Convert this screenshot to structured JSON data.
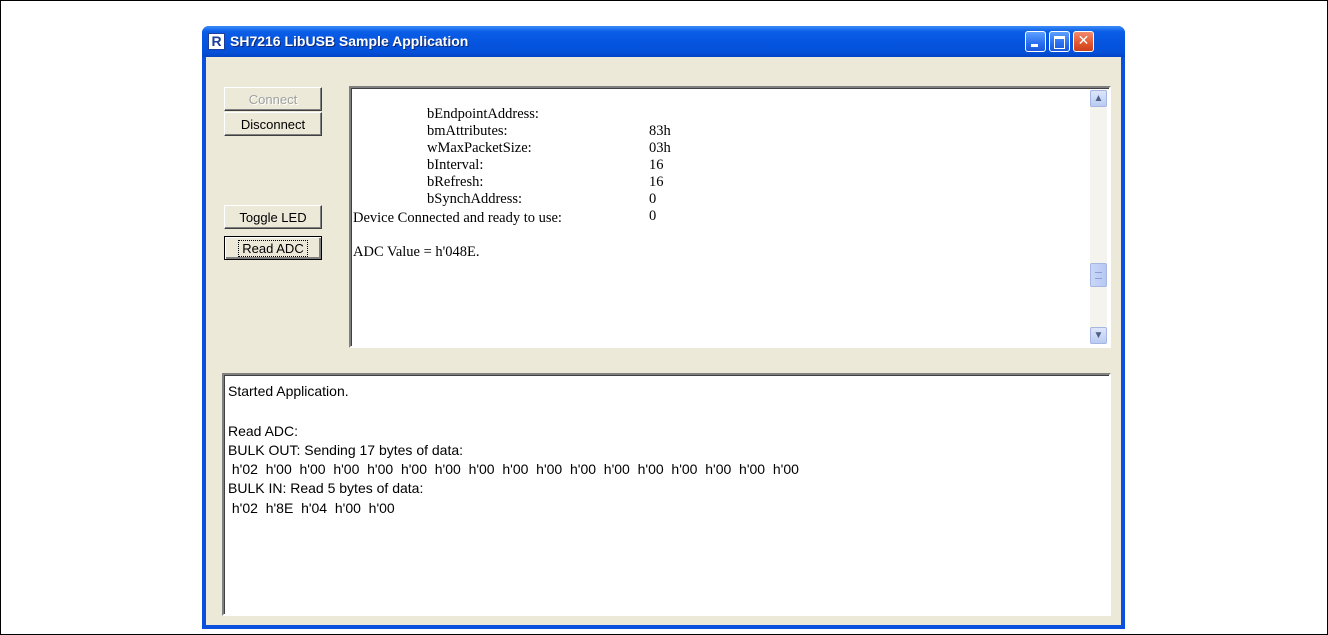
{
  "window": {
    "title": "SH7216 LibUSB Sample Application",
    "app_icon_letter": "R",
    "close_glyph": "✕"
  },
  "buttons": {
    "connect": "Connect",
    "disconnect": "Disconnect",
    "toggle_led": "Toggle LED",
    "read_adc": "Read ADC"
  },
  "descriptor_box": {
    "fields": [
      {
        "key": "bEndpointAddress:",
        "value": "83h"
      },
      {
        "key": "bmAttributes:",
        "value": "03h"
      },
      {
        "key": "wMaxPacketSize:",
        "value": "16"
      },
      {
        "key": "bInterval:",
        "value": "16"
      },
      {
        "key": "bRefresh:",
        "value": "0"
      },
      {
        "key": "bSynchAddress:",
        "value": "0"
      }
    ],
    "status_line": "Device Connected and ready to use:",
    "adc_line": "ADC Value = h'048E.",
    "scroll_up_glyph": "▲",
    "scroll_down_glyph": "▼"
  },
  "log_box": {
    "lines": [
      "Started Application.",
      "",
      "Read ADC:",
      "BULK OUT: Sending 17 bytes of data:",
      " h'02  h'00  h'00  h'00  h'00  h'00  h'00  h'00  h'00  h'00  h'00  h'00  h'00  h'00  h'00  h'00  h'00",
      "BULK IN: Read 5 bytes of data:",
      " h'02  h'8E  h'04  h'00  h'00"
    ]
  }
}
